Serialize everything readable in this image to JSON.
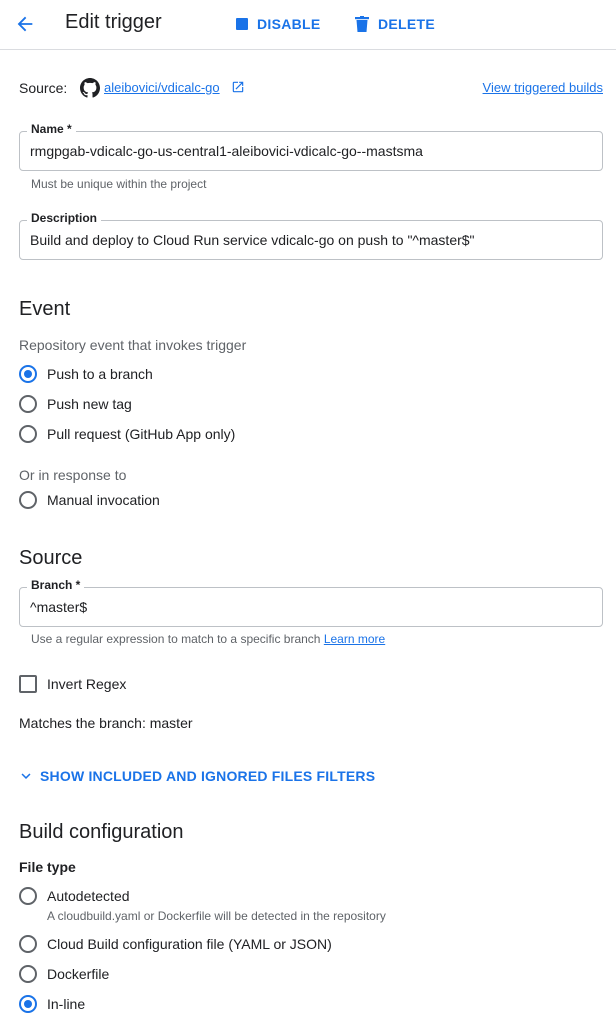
{
  "header": {
    "title": "Edit trigger",
    "disable_label": "DISABLE",
    "delete_label": "DELETE",
    "accent_color": "#1a73e8",
    "icons": {
      "back": "arrow-back-icon",
      "disable": "stop-square-icon",
      "delete": "trash-icon"
    }
  },
  "source_row": {
    "label": "Source:",
    "repo": "aleibovici/vdicalc-go",
    "view_builds": "View triggered builds",
    "icons": {
      "repo": "github-icon",
      "external": "open-in-new-icon"
    }
  },
  "name_field": {
    "label": "Name *",
    "value": "rmgpgab-vdicalc-go-us-central1-aleibovici-vdicalc-go--mastsma",
    "hint": "Must be unique within the project"
  },
  "description_field": {
    "label": "Description",
    "value": "Build and deploy to Cloud Run service vdicalc-go on push to \"^master$\""
  },
  "event": {
    "title": "Event",
    "subtitle": "Repository event that invokes trigger",
    "options": [
      {
        "label": "Push to a branch",
        "selected": true
      },
      {
        "label": "Push new tag",
        "selected": false
      },
      {
        "label": "Pull request (GitHub App only)",
        "selected": false
      }
    ],
    "or_label": "Or in response to",
    "manual_label": "Manual invocation"
  },
  "source": {
    "title": "Source",
    "branch_label": "Branch *",
    "branch_value": "^master$",
    "branch_hint": "Use a regular expression to match to a specific branch",
    "learn_more": "Learn more",
    "invert_label": "Invert Regex",
    "invert_checked": false,
    "matches_text": "Matches the branch: master",
    "filters_label": "SHOW INCLUDED AND IGNORED FILES FILTERS"
  },
  "build_config": {
    "title": "Build configuration",
    "file_type_label": "File type",
    "options": [
      {
        "label": "Autodetected",
        "selected": false,
        "desc": "A cloudbuild.yaml or Dockerfile will be detected in the repository"
      },
      {
        "label": "Cloud Build configuration file (YAML or JSON)",
        "selected": false
      },
      {
        "label": "Dockerfile",
        "selected": false
      },
      {
        "label": "In-line",
        "selected": true
      }
    ]
  }
}
